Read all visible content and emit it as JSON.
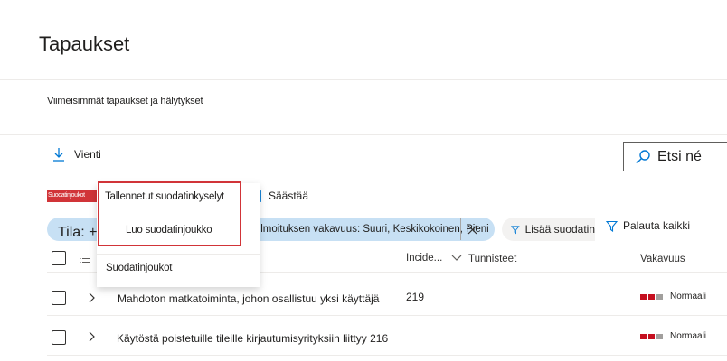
{
  "page": {
    "title": "Tapaukset",
    "tab_label": "Viimeisimmät tapaukset ja hälytykset"
  },
  "toolbar": {
    "export_label": "Vienti",
    "search_placeholder": "Etsi né",
    "filter_sets_label": "Suodatinjoukot",
    "save_label": "Säästää"
  },
  "dropdown": {
    "saved_queries_label": "Tallennetut suodatinkyselyt",
    "create_set_label": "Luo suodatinjoukko",
    "filter_sets_label": "Suodatinjoukot"
  },
  "filters": {
    "state_label": "Tila: +",
    "severity_label": "Ilmoituksen vakavuus: Suuri, Keskikokoinen, Pieni",
    "add_filter_label": "Lisää suodatin",
    "reset_all_label": "Palauta kaikki"
  },
  "table": {
    "columns": {
      "incidents": "Incide...",
      "tags": "Tunnisteet",
      "severity": "Vakavuus"
    },
    "rows": [
      {
        "name": "Mahdoton matkatoiminta, johon osallistuu yksi käyttäjä",
        "id": "219",
        "severity": "Normaali"
      },
      {
        "name": "Käytöstä poistetuille tileille kirjautumisyrityksiin liittyy 216",
        "id": "",
        "severity": "Normaali"
      }
    ]
  },
  "colors": {
    "accent": "#0078d4",
    "highlight_red": "#d13438",
    "pill_blue": "#c7e0f4",
    "severity_red": "#c50f1f",
    "severity_gray": "#a19f9d"
  }
}
